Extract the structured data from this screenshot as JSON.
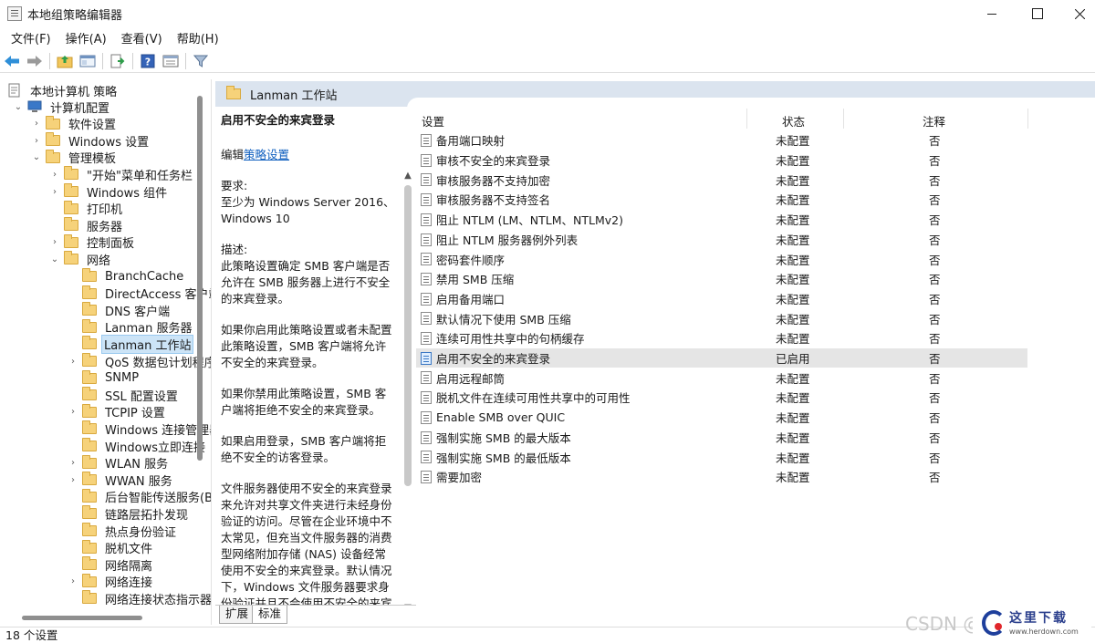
{
  "window": {
    "title": "本地组策略编辑器"
  },
  "menu": [
    "文件(F)",
    "操作(A)",
    "查看(V)",
    "帮助(H)"
  ],
  "toolbar_icons": [
    "back-arrow-icon",
    "forward-arrow-icon",
    "up-folder-icon",
    "show-hide-tree-icon",
    "export-list-icon",
    "help-icon",
    "properties-icon",
    "filter-icon"
  ],
  "tree": {
    "root": "本地计算机 策略",
    "items": [
      {
        "label": "计算机配置",
        "level": 1,
        "chev": "down"
      },
      {
        "label": "软件设置",
        "level": 2,
        "chev": "right"
      },
      {
        "label": "Windows 设置",
        "level": 2,
        "chev": "right"
      },
      {
        "label": "管理模板",
        "level": 2,
        "chev": "down"
      },
      {
        "label": "\"开始\"菜单和任务栏",
        "level": 3,
        "chev": "right"
      },
      {
        "label": "Windows 组件",
        "level": 3,
        "chev": "right"
      },
      {
        "label": "打印机",
        "level": 3,
        "chev": ""
      },
      {
        "label": "服务器",
        "level": 3,
        "chev": ""
      },
      {
        "label": "控制面板",
        "level": 3,
        "chev": "right"
      },
      {
        "label": "网络",
        "level": 3,
        "chev": "down"
      },
      {
        "label": "BranchCache",
        "level": 4,
        "chev": ""
      },
      {
        "label": "DirectAccess 客户端",
        "level": 4,
        "chev": ""
      },
      {
        "label": "DNS 客户端",
        "level": 4,
        "chev": ""
      },
      {
        "label": "Lanman 服务器",
        "level": 4,
        "chev": ""
      },
      {
        "label": "Lanman 工作站",
        "level": 4,
        "chev": "",
        "selected": true
      },
      {
        "label": "QoS 数据包计划程序",
        "level": 4,
        "chev": "right"
      },
      {
        "label": "SNMP",
        "level": 4,
        "chev": ""
      },
      {
        "label": "SSL 配置设置",
        "level": 4,
        "chev": ""
      },
      {
        "label": "TCPIP 设置",
        "level": 4,
        "chev": "right"
      },
      {
        "label": "Windows 连接管理器",
        "level": 4,
        "chev": ""
      },
      {
        "label": "Windows立即连接",
        "level": 4,
        "chev": ""
      },
      {
        "label": "WLAN 服务",
        "level": 4,
        "chev": "right"
      },
      {
        "label": "WWAN 服务",
        "level": 4,
        "chev": "right"
      },
      {
        "label": "后台智能传送服务(BITS)",
        "level": 4,
        "chev": ""
      },
      {
        "label": "链路层拓扑发现",
        "level": 4,
        "chev": ""
      },
      {
        "label": "热点身份验证",
        "level": 4,
        "chev": ""
      },
      {
        "label": "脱机文件",
        "level": 4,
        "chev": ""
      },
      {
        "label": "网络隔离",
        "level": 4,
        "chev": ""
      },
      {
        "label": "网络连接",
        "level": 4,
        "chev": "right"
      },
      {
        "label": "网络连接状态指示器",
        "level": 4,
        "chev": ""
      }
    ]
  },
  "header": {
    "title": "Lanman 工作站"
  },
  "description": {
    "title": "启用不安全的来宾登录",
    "edit_prefix": "编辑",
    "edit_link": "策略设置",
    "req_label": "要求:",
    "req_text": "至少为 Windows Server 2016、Windows 10",
    "desc_label": "描述:",
    "p1": "此策略设置确定 SMB 客户端是否允许在 SMB 服务器上进行不安全的来宾登录。",
    "p2": "如果你启用此策略设置或者未配置此策略设置，SMB 客户端将允许不安全的来宾登录。",
    "p3": "如果你禁用此策略设置，SMB 客户端将拒绝不安全的来宾登录。",
    "p4": "如果启用登录，SMB 客户端将拒绝不安全的访客登录。",
    "p5": "文件服务器使用不安全的来宾登录来允许对共享文件夹进行未经身份验证的访问。尽管在企业环境中不太常见，但充当文件服务器的消费型网络附加存储 (NAS) 设备经常使用不安全的来宾登录。默认情况下，Windows 文件服务器要求身份验证并且不会使用不安全的来宾"
  },
  "tabs": [
    "扩展",
    "标准"
  ],
  "list": {
    "columns": [
      "设置",
      "状态",
      "注释"
    ],
    "rows": [
      {
        "name": "备用端口映射",
        "state": "未配置",
        "comment": "否"
      },
      {
        "name": "审核不安全的来宾登录",
        "state": "未配置",
        "comment": "否"
      },
      {
        "name": "审核服务器不支持加密",
        "state": "未配置",
        "comment": "否"
      },
      {
        "name": "审核服务器不支持签名",
        "state": "未配置",
        "comment": "否"
      },
      {
        "name": "阻止 NTLM (LM、NTLM、NTLMv2)",
        "state": "未配置",
        "comment": "否"
      },
      {
        "name": "阻止 NTLM 服务器例外列表",
        "state": "未配置",
        "comment": "否"
      },
      {
        "name": "密码套件顺序",
        "state": "未配置",
        "comment": "否"
      },
      {
        "name": "禁用 SMB 压缩",
        "state": "未配置",
        "comment": "否"
      },
      {
        "name": "启用备用端口",
        "state": "未配置",
        "comment": "否"
      },
      {
        "name": "默认情况下使用 SMB 压缩",
        "state": "未配置",
        "comment": "否"
      },
      {
        "name": "连续可用性共享中的句柄缓存",
        "state": "未配置",
        "comment": "否"
      },
      {
        "name": "启用不安全的来宾登录",
        "state": "已启用",
        "comment": "否",
        "highlight": true
      },
      {
        "name": "启用远程邮筒",
        "state": "未配置",
        "comment": "否"
      },
      {
        "name": "脱机文件在连续可用性共享中的可用性",
        "state": "未配置",
        "comment": "否"
      },
      {
        "name": "Enable SMB over QUIC",
        "state": "未配置",
        "comment": "否"
      },
      {
        "name": "强制实施 SMB 的最大版本",
        "state": "未配置",
        "comment": "否"
      },
      {
        "name": "强制实施 SMB 的最低版本",
        "state": "未配置",
        "comment": "否"
      },
      {
        "name": "需要加密",
        "state": "未配置",
        "comment": "否"
      }
    ]
  },
  "status": {
    "text": "18 个设置"
  },
  "watermark": {
    "text": "CSDN @",
    "logo_chars": "这里下载",
    "logo_url": "www.herdown.com"
  }
}
